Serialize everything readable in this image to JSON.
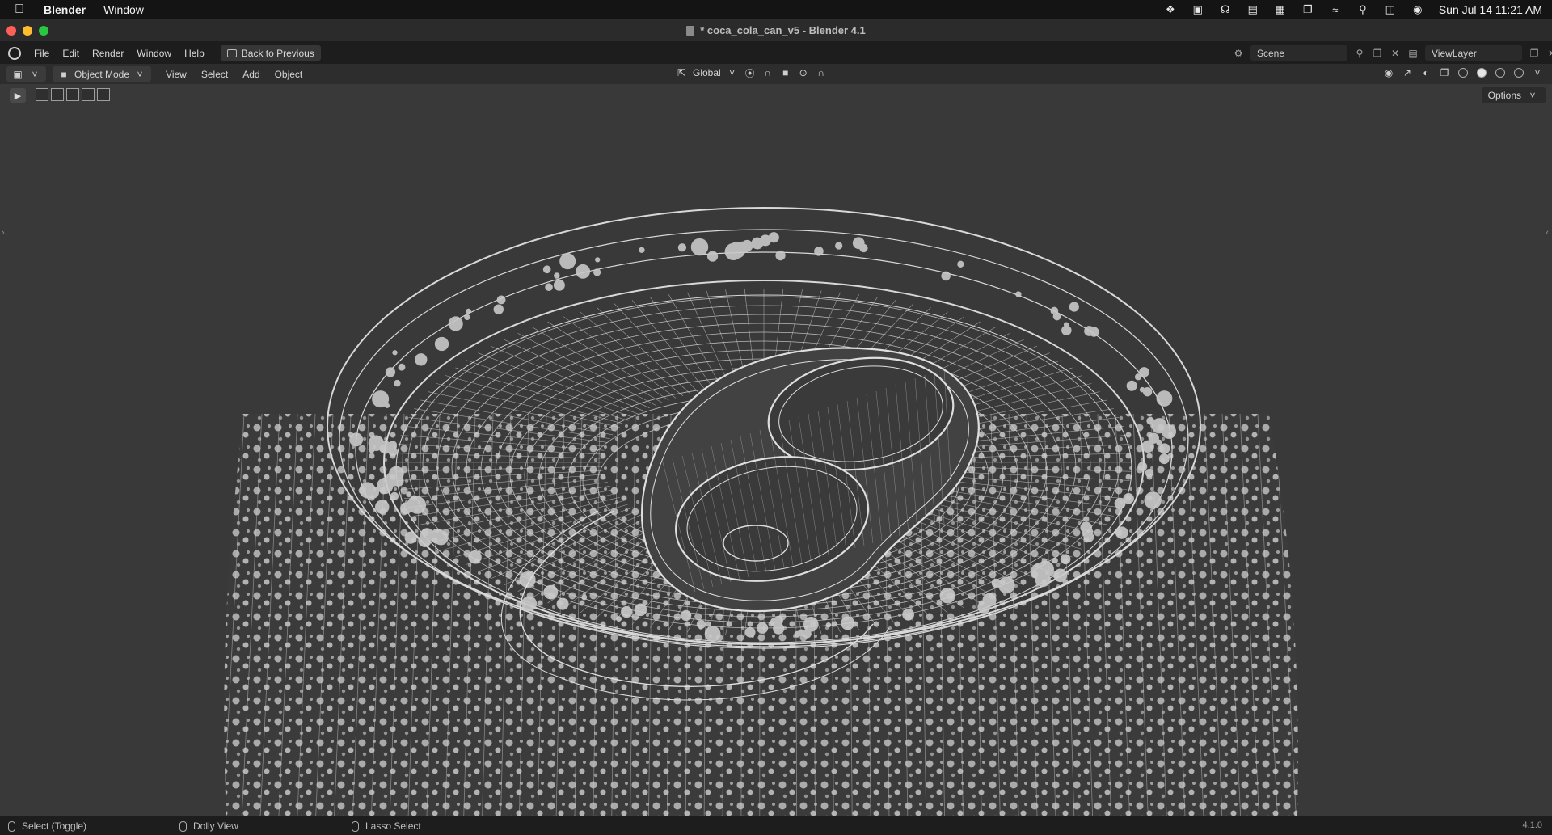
{
  "menubar": {
    "app_name": "Blender",
    "menus": [
      "Window"
    ],
    "clock": "Sun Jul 14  11:21 AM",
    "status_icons": [
      "dropbox-icon",
      "screen-record-icon",
      "headphones-icon",
      "sidebar-icon",
      "stage-manager-icon",
      "window-icon",
      "wifi-icon",
      "search-icon",
      "control-center-icon",
      "siri-icon"
    ]
  },
  "window": {
    "title": "* coca_cola_can_v5 - Blender 4.1"
  },
  "topbar": {
    "menus": [
      "File",
      "Edit",
      "Render",
      "Window",
      "Help"
    ],
    "back_button": "Back to Previous",
    "scene_field": "Scene",
    "viewlayer_field": "ViewLayer"
  },
  "viewport_header": {
    "mode": "Object Mode",
    "menus": [
      "View",
      "Select",
      "Add",
      "Object"
    ],
    "transform_orientation": "Global"
  },
  "toolrow": {
    "options_label": "Options"
  },
  "statusbar": {
    "items": [
      "Select (Toggle)",
      "Dolly View",
      "Lasso Select"
    ],
    "version": "4.1.0"
  },
  "colors": {
    "viewport_bg": "#393939",
    "wire": "#d8d8d8"
  }
}
